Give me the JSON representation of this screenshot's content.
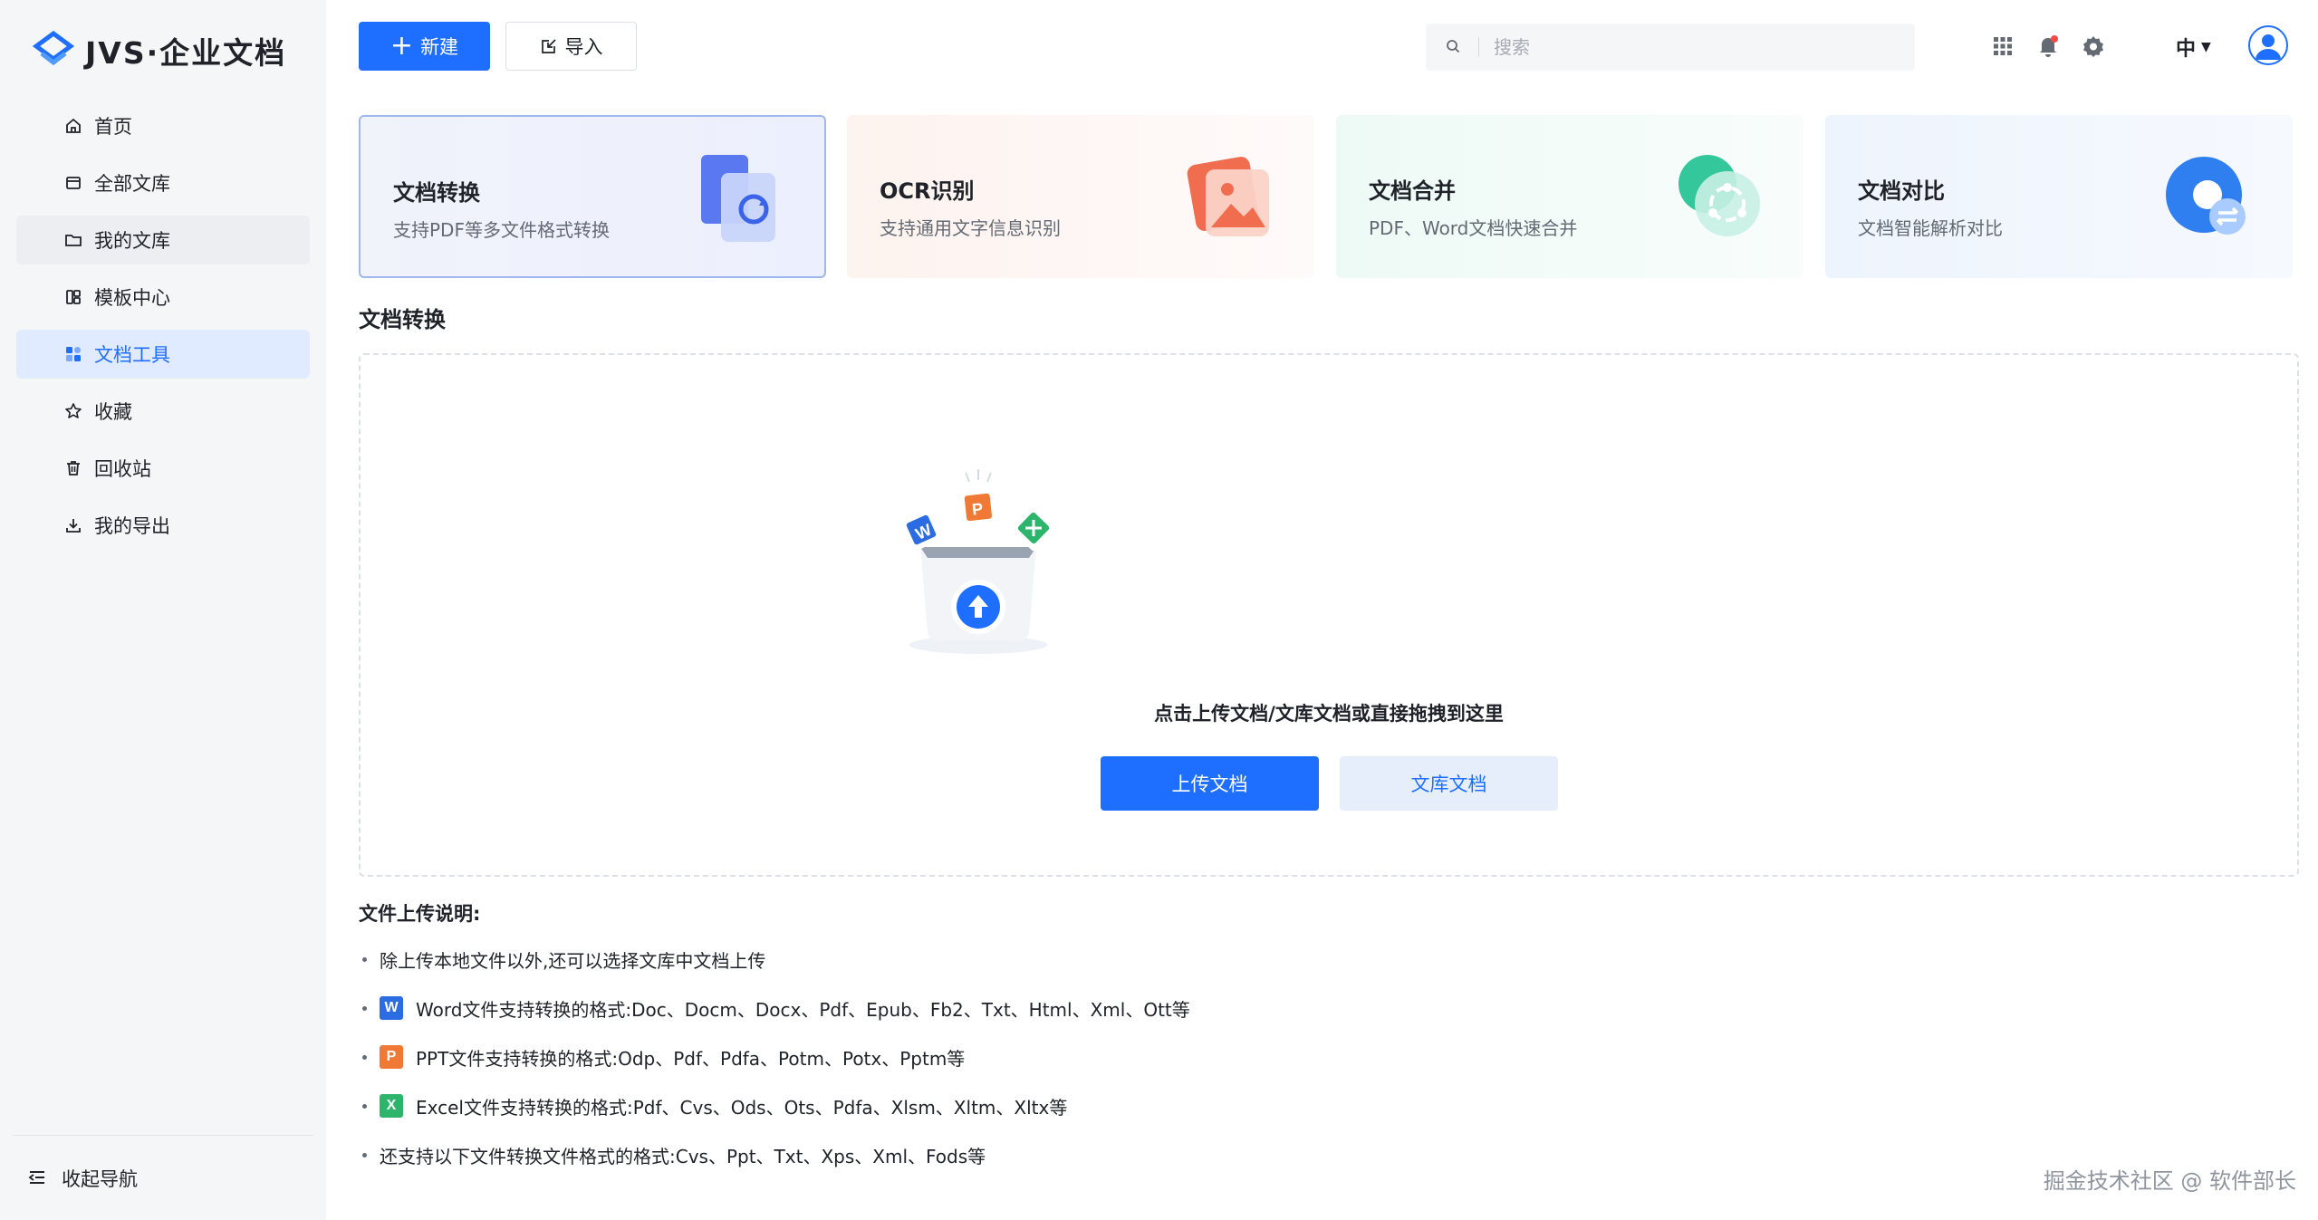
{
  "app": {
    "logo_text": "JVS·企业文档"
  },
  "sidebar": {
    "items": [
      {
        "label": "首页",
        "icon": "home-icon"
      },
      {
        "label": "全部文库",
        "icon": "library-icon"
      },
      {
        "label": "我的文库",
        "icon": "folder-icon"
      },
      {
        "label": "模板中心",
        "icon": "template-icon"
      },
      {
        "label": "文档工具",
        "icon": "tools-icon"
      },
      {
        "label": "收藏",
        "icon": "star-icon"
      },
      {
        "label": "回收站",
        "icon": "trash-icon"
      },
      {
        "label": "我的导出",
        "icon": "download-icon"
      }
    ],
    "collapse_label": "收起导航"
  },
  "header": {
    "new_label": "新建",
    "import_label": "导入",
    "search_placeholder": "搜索",
    "lang_label": "中"
  },
  "cards": [
    {
      "title": "文档转换",
      "desc": "支持PDF等多文件格式转换"
    },
    {
      "title": "OCR识别",
      "desc": "支持通用文字信息识别"
    },
    {
      "title": "文档合并",
      "desc": "PDF、Word文档快速合并"
    },
    {
      "title": "文档对比",
      "desc": "文档智能解析对比"
    }
  ],
  "section_title": "文档转换",
  "dropzone": {
    "hint": "点击上传文档/文库文档或直接拖拽到这里",
    "upload_label": "上传文档",
    "library_label": "文库文档"
  },
  "notes": {
    "title": "文件上传说明:",
    "items": [
      "除上传本地文件以外,还可以选择文库中文档上传",
      "Word文件支持转换的格式:Doc、Docm、Docx、Pdf、Epub、Fb2、Txt、Html、Xml、Ott等",
      "PPT文件支持转换的格式:Odp、Pdf、Pdfa、Potm、Potx、Pptm等",
      "Excel文件支持转换的格式:Pdf、Cvs、Ods、Ots、Pdfa、Xlsm、Xltm、Xltx等",
      "还支持以下文件转换文件格式的格式:Cvs、Ppt、Txt、Xps、Xml、Fods等"
    ]
  },
  "watermark": "掘金技术社区 @ 软件部长",
  "colors": {
    "accent": "#1e6fff",
    "word": "#2b6ce3",
    "ppt": "#f07a35",
    "excel": "#2cb56b"
  }
}
